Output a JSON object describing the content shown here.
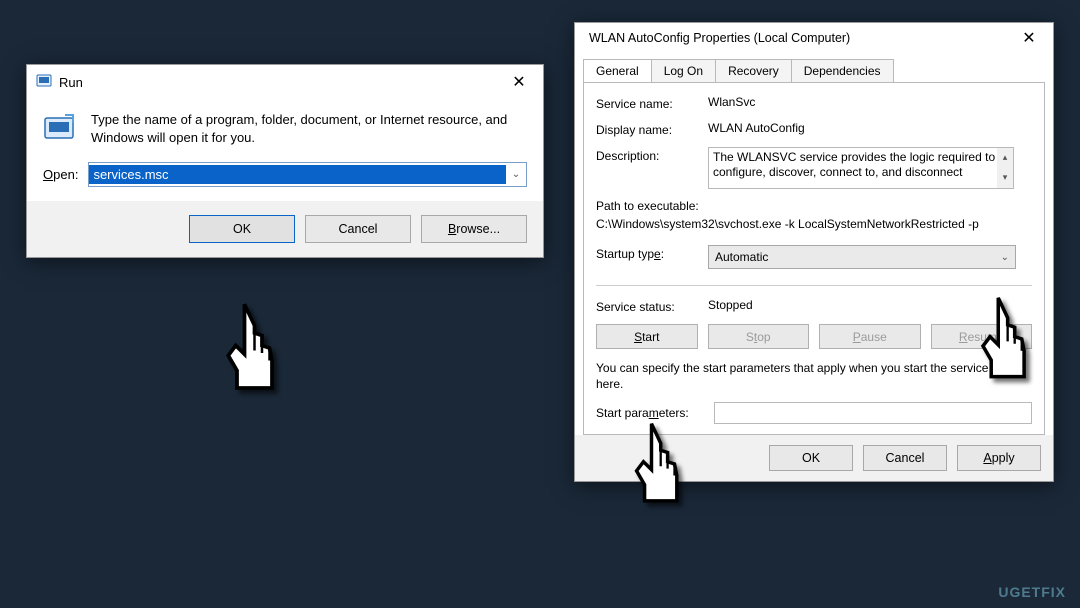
{
  "run": {
    "title": "Run",
    "description": "Type the name of a program, folder, document, or Internet resource, and Windows will open it for you.",
    "open_label": "Open:",
    "open_value": "services.msc",
    "buttons": {
      "ok": "OK",
      "cancel": "Cancel",
      "browse": "Browse..."
    }
  },
  "props": {
    "title": "WLAN AutoConfig Properties (Local Computer)",
    "tabs": [
      "General",
      "Log On",
      "Recovery",
      "Dependencies"
    ],
    "active_tab": 0,
    "service_name_label": "Service name:",
    "service_name": "WlanSvc",
    "display_name_label": "Display name:",
    "display_name": "WLAN AutoConfig",
    "description_label": "Description:",
    "description": "The WLANSVC service provides the logic required to configure, discover, connect to, and disconnect",
    "path_label": "Path to executable:",
    "path": "C:\\Windows\\system32\\svchost.exe -k LocalSystemNetworkRestricted -p",
    "startup_label": "Startup type:",
    "startup_value": "Automatic",
    "status_label": "Service status:",
    "status_value": "Stopped",
    "svc_buttons": {
      "start": "Start",
      "stop": "Stop",
      "pause": "Pause",
      "resume": "Resume"
    },
    "note": "You can specify the start parameters that apply when you start the service from here.",
    "start_params_label": "Start parameters:",
    "start_params_value": "",
    "footer": {
      "ok": "OK",
      "cancel": "Cancel",
      "apply": "Apply"
    }
  },
  "watermark": "UGETFIX"
}
